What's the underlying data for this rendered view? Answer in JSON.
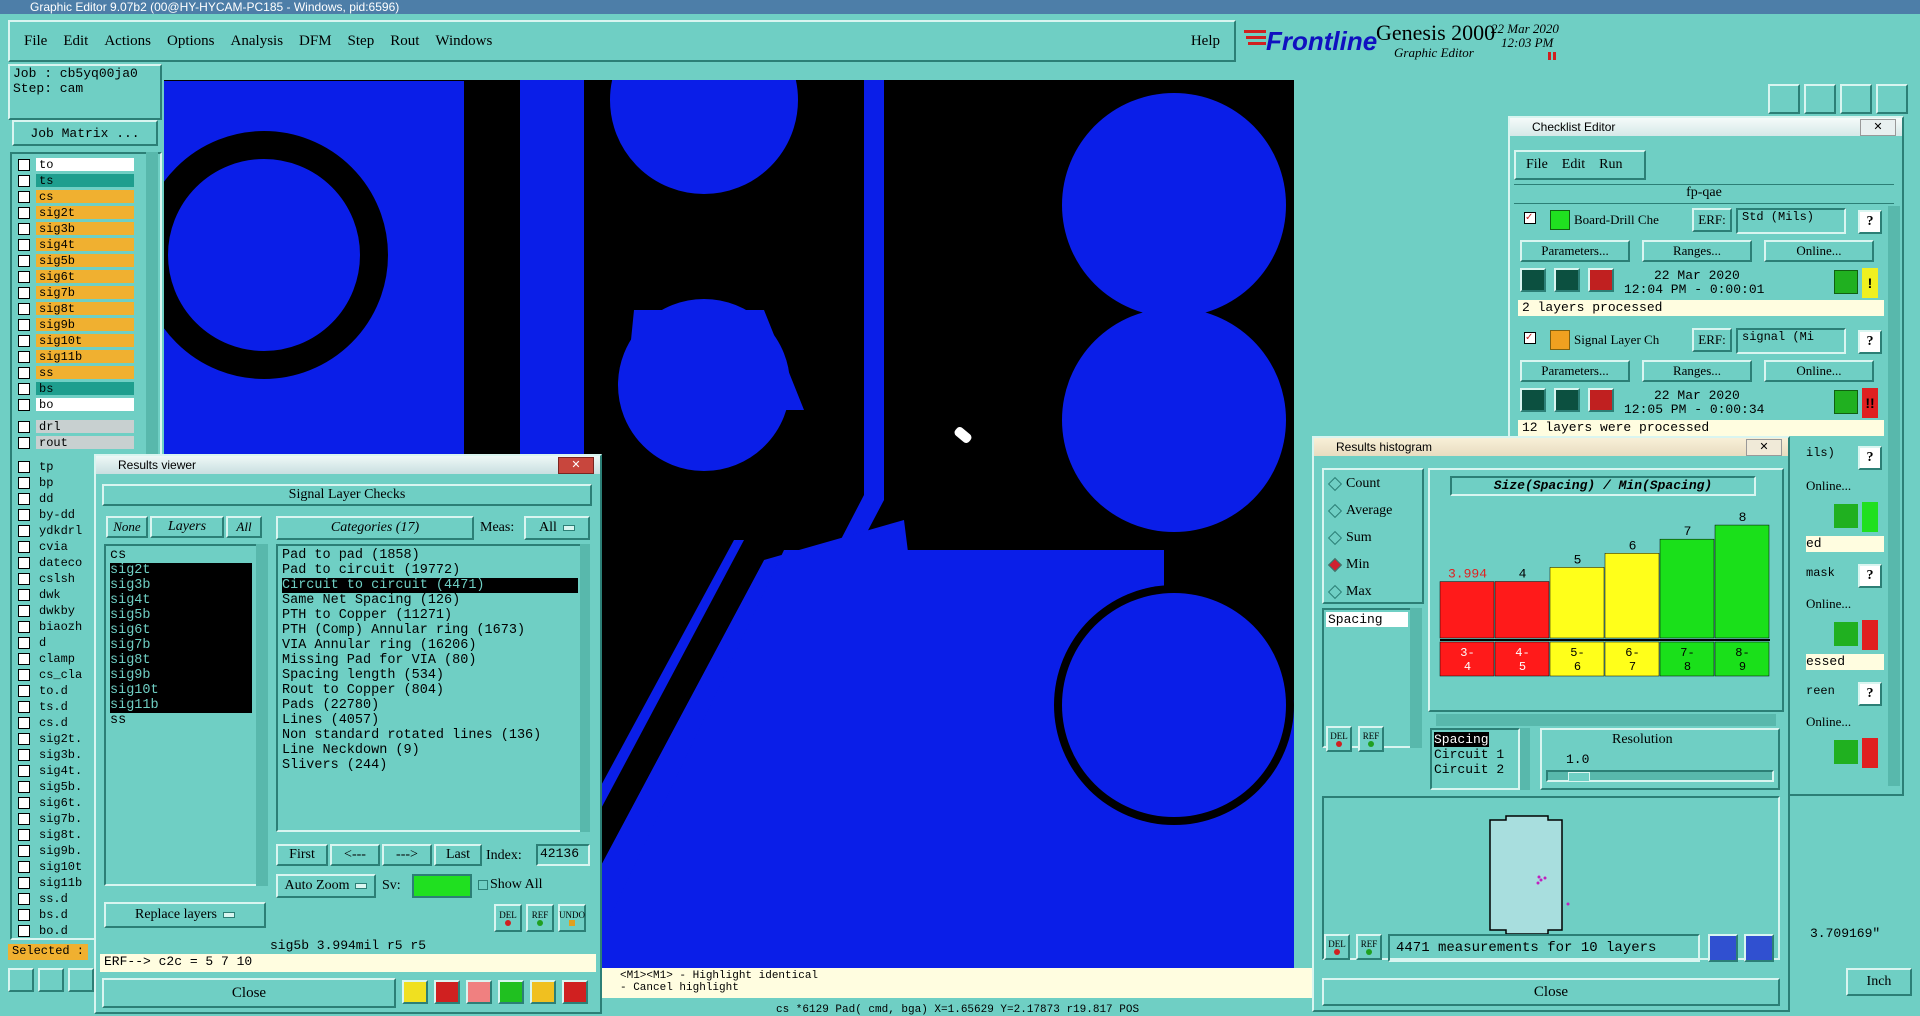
{
  "titlebar": {
    "title": "Graphic Editor 9.07b2 (00@HY-HYCAM-PC185 - Windows, pid:6596)"
  },
  "menu": {
    "items": [
      "File",
      "Edit",
      "Actions",
      "Options",
      "Analysis",
      "DFM",
      "Step",
      "Rout",
      "Windows"
    ],
    "help": "Help"
  },
  "brand": {
    "logo": "Frontline",
    "product": "Genesis 2000",
    "subtitle": "Graphic Editor",
    "date": "22 Mar 2020",
    "time": "12:03 PM"
  },
  "job": {
    "job_label": "Job : cb5yq00ja0",
    "step_label": "Step: cam",
    "matrix_button": "Job Matrix ..."
  },
  "layers_top": [
    {
      "name": "to",
      "color": "#ffffff"
    },
    {
      "name": "ts",
      "color": "#1e9e8e"
    },
    {
      "name": "cs",
      "color": "#f0b030"
    },
    {
      "name": "sig2t",
      "color": "#f0b030"
    },
    {
      "name": "sig3b",
      "color": "#f0b030"
    },
    {
      "name": "sig4t",
      "color": "#f0b030"
    },
    {
      "name": "sig5b",
      "color": "#f0b030"
    },
    {
      "name": "sig6t",
      "color": "#f0b030"
    },
    {
      "name": "sig7b",
      "color": "#f0b030"
    },
    {
      "name": "sig8t",
      "color": "#f0b030"
    },
    {
      "name": "sig9b",
      "color": "#f0b030"
    },
    {
      "name": "sig10t",
      "color": "#f0b030"
    },
    {
      "name": "sig11b",
      "color": "#f0b030"
    },
    {
      "name": "ss",
      "color": "#f0b030"
    },
    {
      "name": "bs",
      "color": "#1e9e8e"
    },
    {
      "name": "bo",
      "color": "#ffffff"
    }
  ],
  "layers_drill": [
    {
      "name": "drl",
      "color": "#c8d0d0"
    },
    {
      "name": "rout",
      "color": "#c8d0d0"
    }
  ],
  "layers_misc": [
    "tp",
    "bp",
    "dd",
    "by-dd",
    "ydkdrl",
    "cvia",
    "dateco",
    "cslsh",
    "dwk",
    "dwkby",
    "biaozh",
    "d",
    "clamp",
    "cs_cla",
    "to.d",
    "ts.d",
    "cs.d",
    "sig2t.",
    "sig3b.",
    "sig4t.",
    "sig5b.",
    "sig6t.",
    "sig7b.",
    "sig8t.",
    "sig9b.",
    "sig10t",
    "sig11b",
    "ss.d",
    "bs.d",
    "bo.d"
  ],
  "selected_label": "Selected :",
  "results_viewer": {
    "title": "Results viewer",
    "heading": "Signal Layer Checks",
    "none_btn": "None",
    "layers_btn": "Layers",
    "all_btn": "All",
    "categories_btn": "Categories (17)",
    "meas_label": "Meas:",
    "meas_value": "All",
    "layers": [
      "cs",
      "sig2t",
      "sig3b",
      "sig4t",
      "sig5b",
      "sig6t",
      "sig7b",
      "sig8t",
      "sig9b",
      "sig10t",
      "sig11b",
      "ss"
    ],
    "categories": [
      "Pad to pad (1858)",
      "Pad to circuit (19772)",
      "Circuit to circuit (4471)",
      "Same Net Spacing (126)",
      "PTH to Copper (11271)",
      "PTH (Comp) Annular ring (1673)",
      "VIA Annular ring (16206)",
      "Missing Pad for VIA (80)",
      "Spacing length (534)",
      "Rout to Copper (804)",
      "Pads (22780)",
      "Lines (4057)",
      "Non standard rotated lines (136)",
      "Line Neckdown (9)",
      "Slivers (244)"
    ],
    "first_btn": "First",
    "prev_btn": "<---",
    "next_btn": "--->",
    "last_btn": "Last",
    "index_label": "Index:",
    "index_value": "42136",
    "autozoom": "Auto Zoom",
    "sv_label": "Sv:",
    "showall": "Show All",
    "replace_layers": "Replace layers",
    "del": "DEL",
    "ref": "REF",
    "undo": "UNDO",
    "status": "sig5b 3.994mil  r5  r5",
    "erf_line": "ERF--> c2c = 5 7 10",
    "close": "Close"
  },
  "histogram": {
    "title": "Results histogram",
    "chart_title": "Size(Spacing) / Min(Spacing)",
    "options": [
      "Count",
      "Average",
      "Sum",
      "Min",
      "Max"
    ],
    "selected_option": "Min",
    "list_label": "Spacing",
    "del": "DEL",
    "ref": "REF",
    "sel_list": [
      "Spacing",
      "Circuit 1",
      "Circuit 2"
    ],
    "resolution_label": "Resolution",
    "resolution_value": "1.0",
    "footer": "4471 measurements for 10 layers",
    "close": "Close"
  },
  "chart_data": {
    "type": "bar",
    "title": "Size(Spacing) / Min(Spacing)",
    "categories": [
      "3-4",
      "4-5",
      "5-6",
      "6-7",
      "7-8",
      "8-9"
    ],
    "values": [
      3.994,
      4,
      5,
      6,
      7,
      8
    ],
    "labels": [
      "3.994",
      "4",
      "5",
      "6",
      "7",
      "8"
    ],
    "colors": [
      "#ff1a1a",
      "#ff1a1a",
      "#ffff1a",
      "#ffff1a",
      "#1ae01a",
      "#1ae01a"
    ],
    "ylim": [
      0,
      8.5
    ]
  },
  "checklist": {
    "title": "Checklist Editor",
    "menu": [
      "File",
      "Edit",
      "Run"
    ],
    "name": "fp-qae",
    "checks": [
      {
        "name": "Board-Drill Che",
        "erf": "ERF:",
        "erf_value": "Std (Mils)",
        "params": "Parameters...",
        "ranges": "Ranges...",
        "online": "Online...",
        "date": "22 Mar 2020",
        "time": "12:04 PM - 0:00:01",
        "status": "2 layers processed",
        "badge": "!",
        "badge_color": "#f0f020"
      },
      {
        "name": "Signal Layer Ch",
        "erf": "ERF:",
        "erf_value": "signal (Mi",
        "params": "Parameters...",
        "ranges": "Ranges...",
        "online": "Online...",
        "date": "22 Mar 2020",
        "time": "12:05 PM - 0:00:34",
        "status": "12 layers were processed",
        "badge": "!!",
        "badge_color": "#e02020"
      }
    ],
    "partial": [
      "ils)",
      "Online...",
      "ed",
      "mask",
      "Online...",
      "essed",
      "reen",
      "Online..."
    ]
  },
  "command": {
    "line1": "<M1><M1> - Highlight identical",
    "line2": "- Cancel highlight"
  },
  "coord": "3.709169\"",
  "units": "Inch",
  "bottom_status": "cs  *6129 Pad( cmd, bga) X=1.65629 Y=2.17873 r19.817 POS"
}
